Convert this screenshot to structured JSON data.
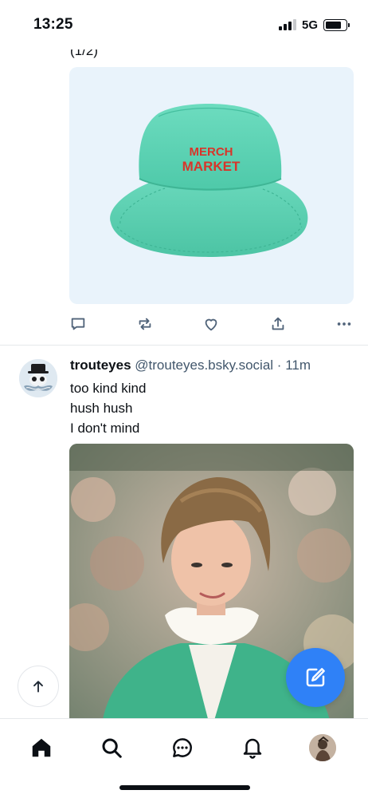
{
  "status_bar": {
    "time": "13:25",
    "network": "5G",
    "signal_bars_active": 3,
    "signal_bars_total": 4,
    "battery_level": 0.8
  },
  "feed": {
    "previous_post": {
      "clipped_text": "(1/2)",
      "media": {
        "hat_text_line1": "MERCH",
        "hat_text_line2": "MARKET"
      },
      "actions": [
        {
          "icon": "reply-icon"
        },
        {
          "icon": "repost-icon"
        },
        {
          "icon": "like-icon"
        },
        {
          "icon": "share-icon"
        },
        {
          "icon": "more-icon"
        }
      ]
    },
    "post": {
      "display_name": "trouteyes",
      "handle": "@trouteyes.bsky.social",
      "separator": "·",
      "time": "11m",
      "text_lines": [
        "too kind kind",
        "hush hush",
        "I don't mind"
      ]
    }
  },
  "floating": {
    "scroll_top_icon": "arrow-up-icon",
    "compose_icon": "compose-icon"
  },
  "bottom_nav": [
    {
      "name": "home",
      "icon": "home-icon",
      "active": true
    },
    {
      "name": "search",
      "icon": "search-icon",
      "active": false
    },
    {
      "name": "chat",
      "icon": "chat-icon",
      "active": false
    },
    {
      "name": "notifications",
      "icon": "bell-icon",
      "active": false
    },
    {
      "name": "profile",
      "icon": "avatar",
      "active": false
    }
  ],
  "colors": {
    "accent": "#2f81f7",
    "text_primary": "#0b0f14",
    "text_secondary": "#42576c",
    "icon_muted": "#51647a",
    "media_bg": "#e9f3fb",
    "hat": "#5fd3b4",
    "hat_text": "#d8352a"
  }
}
